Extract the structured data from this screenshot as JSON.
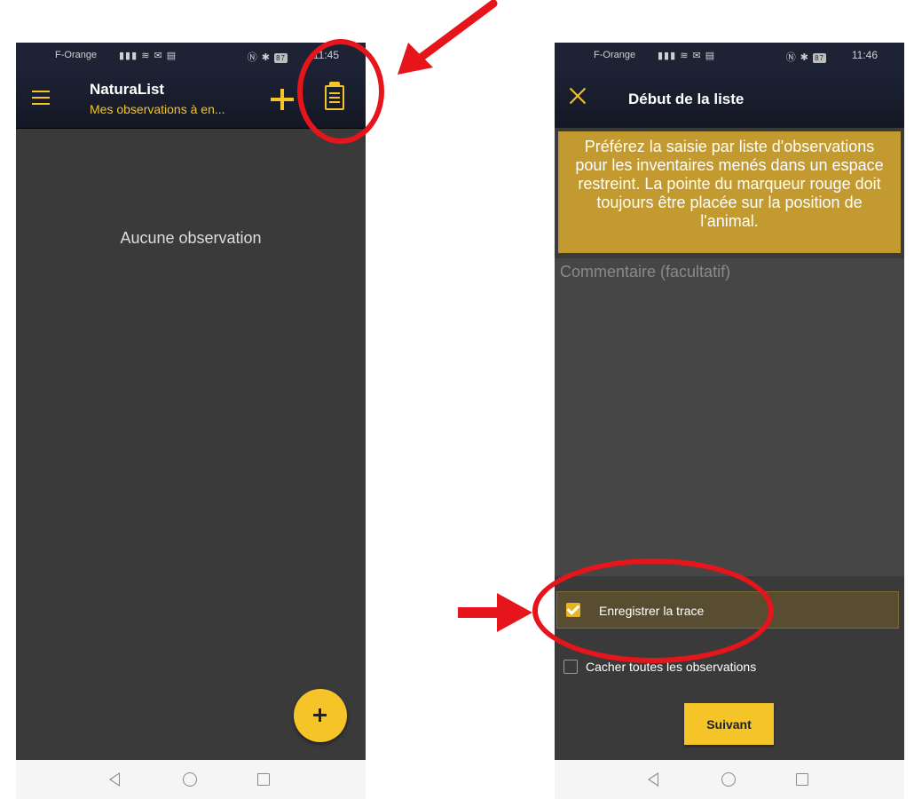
{
  "left_screen": {
    "status": {
      "carrier": "F-Orange",
      "battery": "87",
      "time": "11:45"
    },
    "appbar": {
      "title": "NaturaList",
      "subtitle": "Mes observations à en..."
    },
    "empty_text": "Aucune observation",
    "icons": {
      "menu": "hamburger-icon",
      "add": "plus-icon",
      "list": "clipboard-icon",
      "fab": "plus-icon"
    }
  },
  "right_screen": {
    "status": {
      "carrier": "F-Orange",
      "battery": "87",
      "time": "11:46"
    },
    "appbar": {
      "title": "Début de la liste"
    },
    "info_banner": "Préférez la saisie par liste d'observations pour les inventaires menés dans un espace restreint. La pointe du marqueur rouge doit toujours être placée sur la position de l'animal.",
    "comment_placeholder": "Commentaire (facultatif)",
    "record_track": {
      "label": "Enregistrer la trace",
      "checked": true
    },
    "hide_observations": {
      "label": "Cacher toutes les observations",
      "checked": false
    },
    "next_button": "Suivant"
  },
  "colors": {
    "accent": "#f5c428",
    "banner": "#c29a30",
    "annotation": "#e5151b",
    "appbar": "#1d2335"
  }
}
